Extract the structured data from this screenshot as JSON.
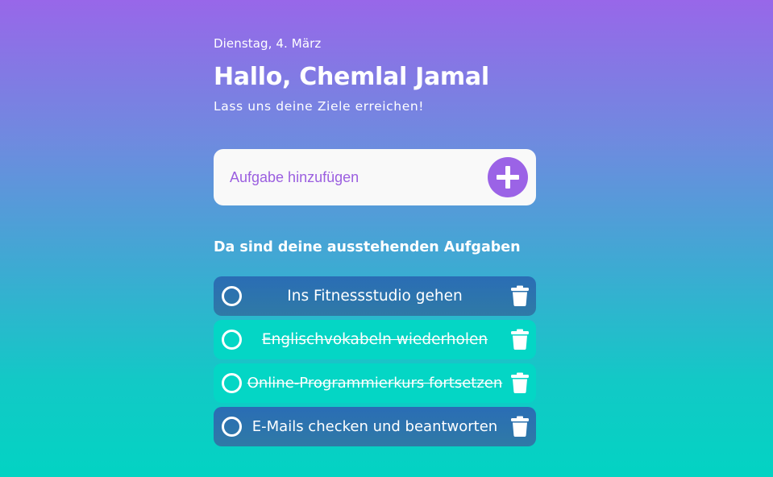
{
  "header": {
    "date": "Dienstag, 4. März",
    "greeting": "Hallo, Chemlal Jamal",
    "subtitle": "Lass uns deine Ziele erreichen!"
  },
  "add_task": {
    "placeholder": "Aufgabe hinzufügen",
    "button_icon": "plus-icon"
  },
  "section_title": "Da sind deine ausstehenden Aufgaben",
  "tasks": [
    {
      "label": "Ins Fitnessstudio gehen",
      "completed": false
    },
    {
      "label": "Englischvokabeln wiederholen",
      "completed": true
    },
    {
      "label": "Online-Programmierkurs fortsetzen",
      "completed": true
    },
    {
      "label": "E-Mails checken und beantworten",
      "completed": false
    }
  ],
  "icons": {
    "checkbox": "circle-checkbox-icon",
    "delete": "trash-icon"
  },
  "colors": {
    "accent": "#9b63e6",
    "pending_task": "#2a6db5",
    "completed_task": "#04d6c5",
    "input_bg": "#f9f9f9"
  }
}
